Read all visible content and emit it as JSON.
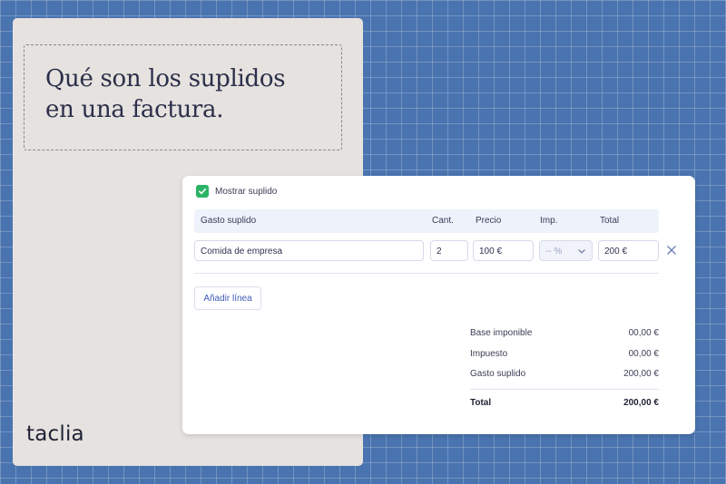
{
  "hero": {
    "title_line1": "Qué son los suplidos",
    "title_line2": "en una factura."
  },
  "brand": {
    "logo_text": "taclia"
  },
  "form": {
    "toggle_label": "Mostrar suplido",
    "toggle_checked": true,
    "headers": {
      "expense": "Gasto suplido",
      "qty": "Cant.",
      "price": "Precio",
      "tax": "Imp.",
      "total": "Total"
    },
    "row": {
      "expense": "Comida de empresa",
      "qty": "2",
      "price": "100 €",
      "tax_placeholder": "-- %",
      "total": "200 €"
    },
    "add_line_label": "Añadir línea",
    "summary": {
      "base_label": "Base imponible",
      "base_value": "00,00 €",
      "tax_label": "Impuesto",
      "tax_value": "00,00 €",
      "expense_label": "Gasto suplido",
      "expense_value": "200,00 €",
      "total_label": "Total",
      "total_value": "200,00 €"
    }
  },
  "colors": {
    "background": "#4a74b0",
    "panel": "#e6e2df",
    "accent_green": "#2ab364",
    "link_blue": "#3d5bb8",
    "text_dark": "#2b2f4a"
  },
  "icons": [
    "checkmark-icon",
    "chevron-down-icon",
    "close-icon"
  ]
}
